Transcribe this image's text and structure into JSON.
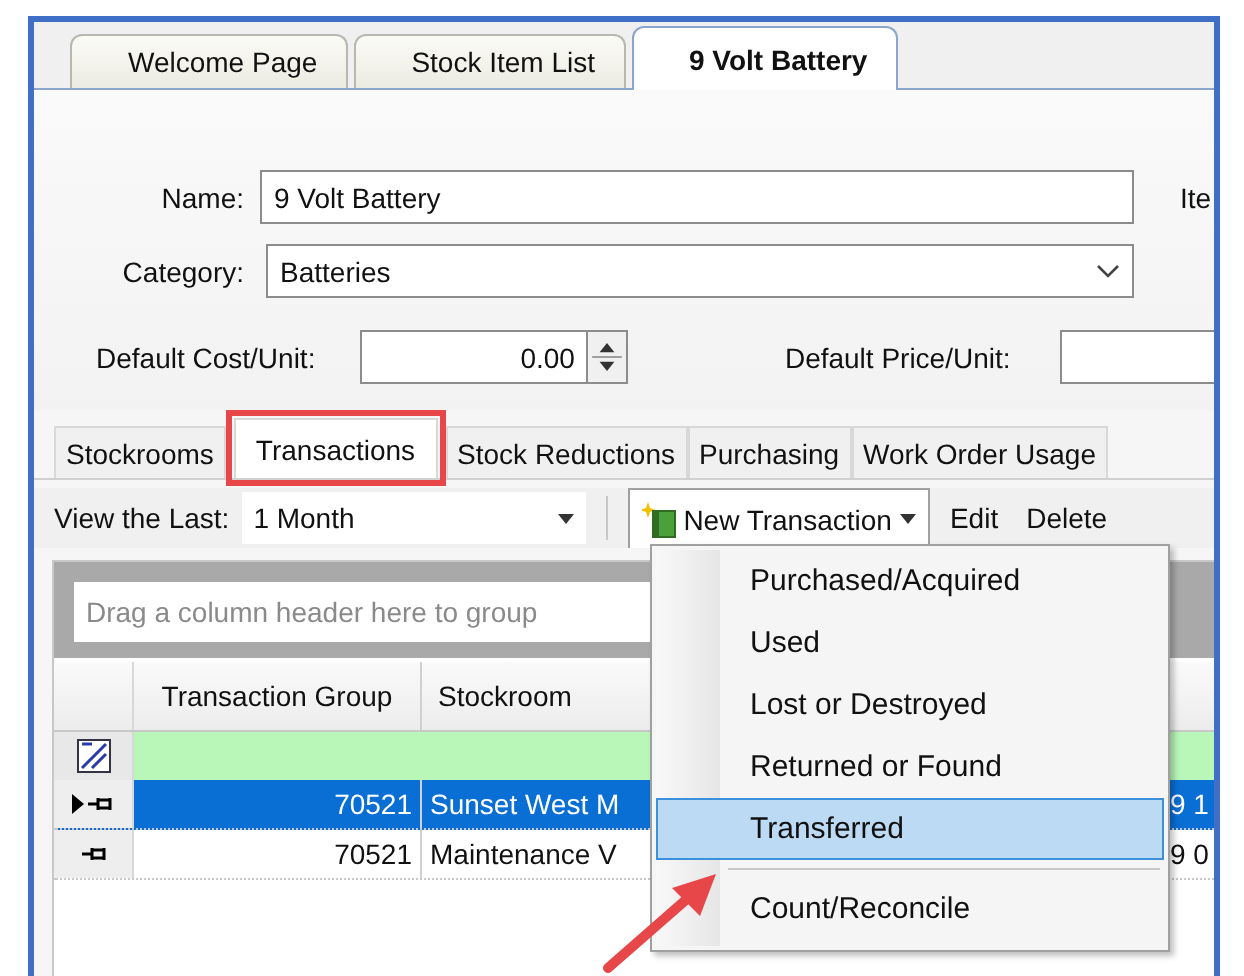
{
  "document_tabs": [
    {
      "label": "Welcome Page",
      "selected": false
    },
    {
      "label": "Stock Item List",
      "selected": false
    },
    {
      "label": "9 Volt Battery",
      "selected": true
    }
  ],
  "form": {
    "name_label": "Name:",
    "name_value": "9 Volt Battery",
    "cut_label": "Ite",
    "category_label": "Category:",
    "category_value": "Batteries",
    "cost_label": "Default Cost/Unit:",
    "cost_value": "0.00",
    "price_label": "Default Price/Unit:"
  },
  "tabs": [
    {
      "label": "Stockrooms",
      "selected": false,
      "highlighted": false
    },
    {
      "label": "Transactions",
      "selected": true,
      "highlighted": true
    },
    {
      "label": "Stock Reductions",
      "selected": false,
      "highlighted": false
    },
    {
      "label": "Purchasing",
      "selected": false,
      "highlighted": false
    },
    {
      "label": "Work Order Usage",
      "selected": false,
      "highlighted": false
    }
  ],
  "toolbar": {
    "view_label": "View the Last:",
    "view_value": "1 Month",
    "new_button": "New Transaction",
    "edit_button": "Edit",
    "delete_button": "Delete"
  },
  "grid": {
    "group_hint": "Drag a column header here to group",
    "columns": [
      "Transaction Group",
      "Stockroom"
    ],
    "rows": [
      {
        "selected": true,
        "cells": [
          "70521",
          "Sunset West M",
          "9 1"
        ]
      },
      {
        "selected": false,
        "cells": [
          "70521",
          "Maintenance V",
          "9 0"
        ]
      }
    ]
  },
  "menu": {
    "callout_arrow": true,
    "items": [
      {
        "label": "Purchased/Acquired",
        "selected": false
      },
      {
        "label": "Used",
        "selected": false
      },
      {
        "label": "Lost or Destroyed",
        "selected": false
      },
      {
        "label": "Returned or Found",
        "selected": false
      },
      {
        "label": "Transferred",
        "selected": true
      },
      {
        "label": "Count/Reconcile",
        "selected": false,
        "separator_before": true
      }
    ]
  }
}
